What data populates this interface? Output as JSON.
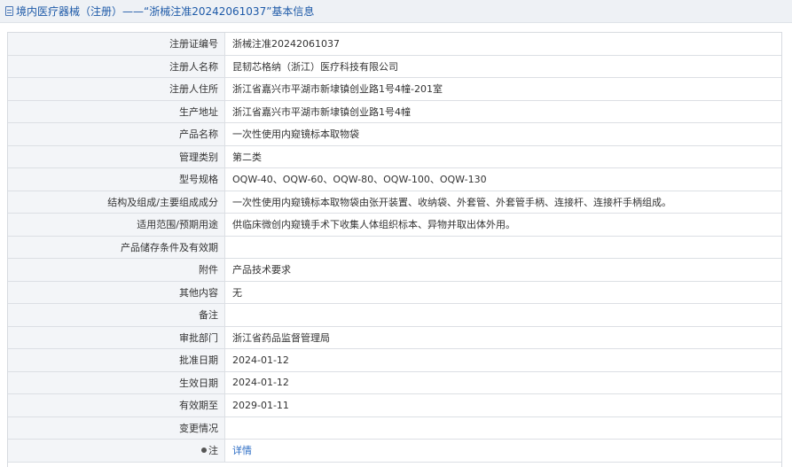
{
  "header": {
    "title": "境内医疗器械（注册）——“浙械注准20242061037”基本信息",
    "icon": "document-icon"
  },
  "rows": [
    {
      "label": "注册证编号",
      "value": "浙械注准20242061037"
    },
    {
      "label": "注册人名称",
      "value": "昆韧芯格纳（浙江）医疗科技有限公司"
    },
    {
      "label": "注册人住所",
      "value": "浙江省嘉兴市平湖市新埭镇创业路1号4幢-201室"
    },
    {
      "label": "生产地址",
      "value": "浙江省嘉兴市平湖市新埭镇创业路1号4幢"
    },
    {
      "label": "产品名称",
      "value": "一次性使用内窥镜标本取物袋"
    },
    {
      "label": "管理类别",
      "value": "第二类"
    },
    {
      "label": "型号规格",
      "value": "OQW-40、OQW-60、OQW-80、OQW-100、OQW-130"
    },
    {
      "label": "结构及组成/主要组成成分",
      "value": "一次性使用内窥镜标本取物袋由张开装置、收纳袋、外套管、外套管手柄、连接杆、连接杆手柄组成。"
    },
    {
      "label": "适用范围/预期用途",
      "value": "供临床微创内窥镜手术下收集人体组织标本、异物并取出体外用。"
    },
    {
      "label": "产品储存条件及有效期",
      "value": ""
    },
    {
      "label": "附件",
      "value": "产品技术要求"
    },
    {
      "label": "其他内容",
      "value": "无"
    },
    {
      "label": "备注",
      "value": ""
    },
    {
      "label": "审批部门",
      "value": "浙江省药品监督管理局"
    },
    {
      "label": "批准日期",
      "value": "2024-01-12"
    },
    {
      "label": "生效日期",
      "value": "2024-01-12"
    },
    {
      "label": "有效期至",
      "value": "2029-01-11"
    },
    {
      "label": "变更情况",
      "value": ""
    }
  ],
  "note": {
    "label": "注",
    "link": "详情",
    "icon": "pin-icon"
  },
  "colors": {
    "header_bg": "#eef1f5",
    "title": "#1e5aa8",
    "label_bg": "#f3f5f8",
    "link": "#2b6cc4"
  }
}
